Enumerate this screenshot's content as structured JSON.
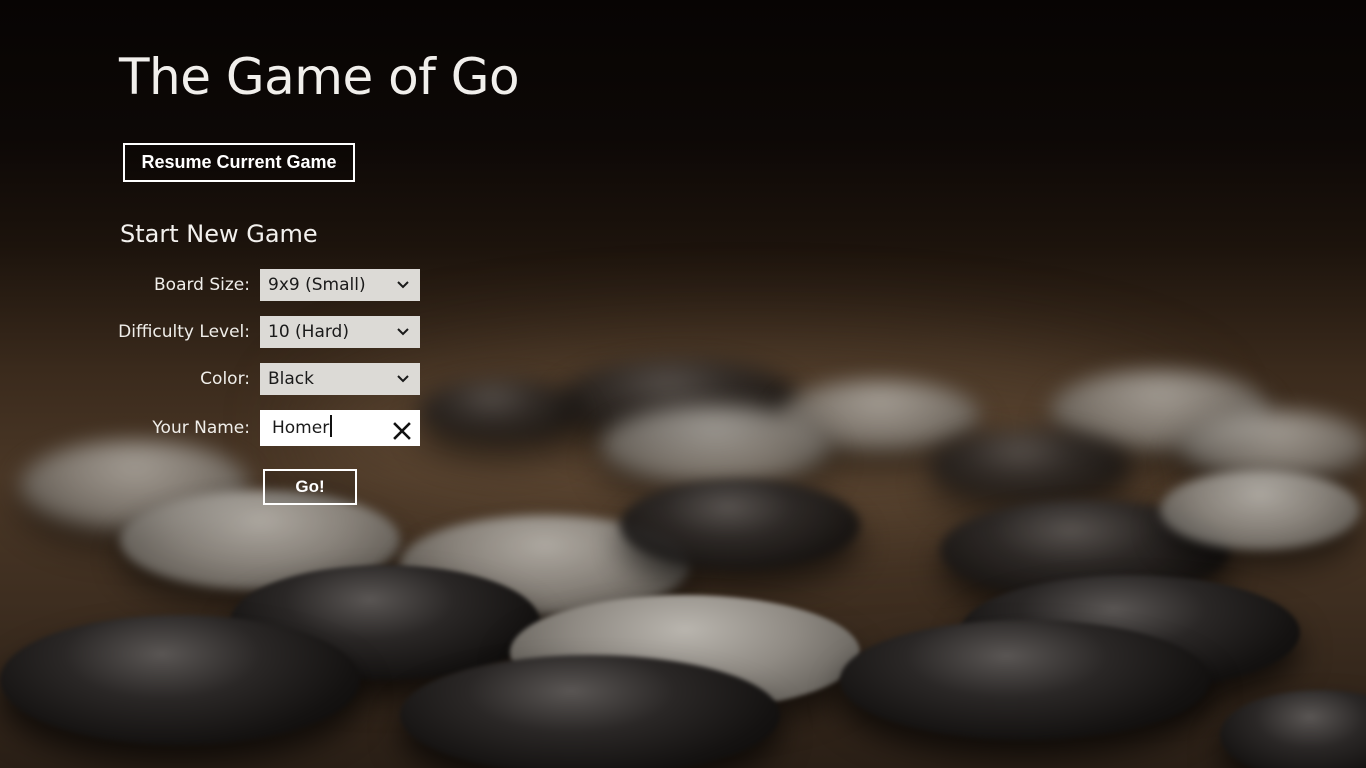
{
  "app": {
    "title": "The Game of Go"
  },
  "resume": {
    "label": "Resume Current Game"
  },
  "new_game": {
    "heading": "Start New Game",
    "board_size": {
      "label": "Board Size:",
      "value": "9x9 (Small)"
    },
    "difficulty": {
      "label": "Difficulty Level:",
      "value": "10 (Hard)"
    },
    "color": {
      "label": "Color:",
      "value": "Black"
    },
    "name": {
      "label": "Your Name:",
      "value": "Homer"
    },
    "go": {
      "label": "Go!"
    }
  },
  "icons": {
    "dropdown": "chevron-down-icon",
    "clear": "close-icon"
  },
  "colors": {
    "text": "#ffffff",
    "field_bg": "#dcdad6",
    "input_bg": "#ffffff"
  }
}
